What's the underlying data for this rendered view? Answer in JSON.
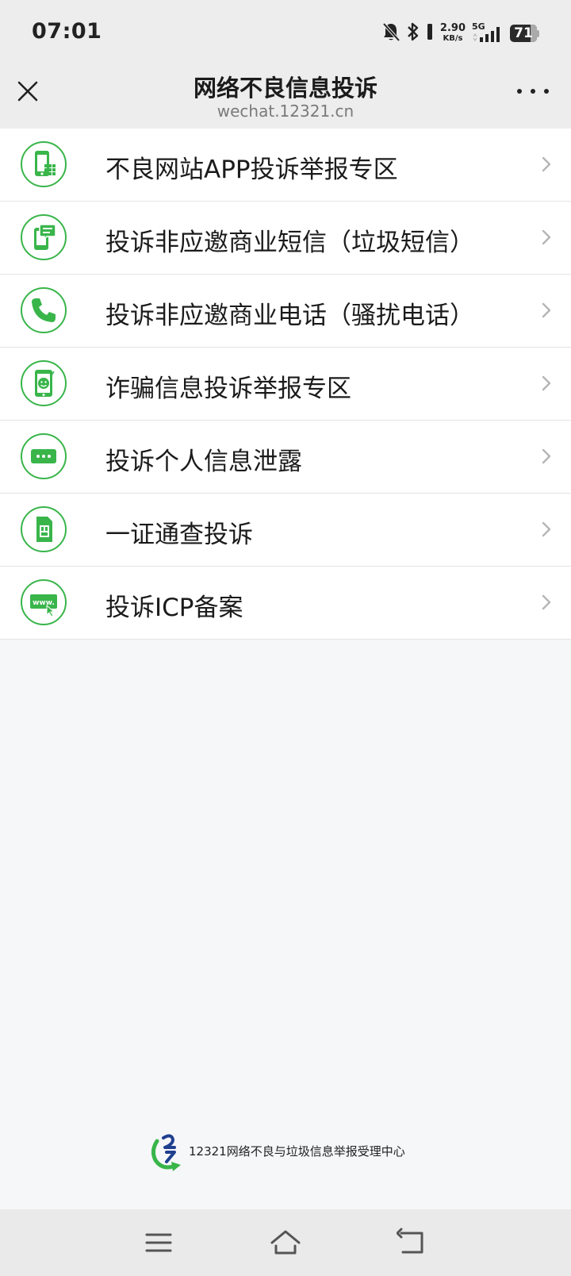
{
  "status_bar": {
    "time": "07:01",
    "net_speed_value": "2.90",
    "net_speed_unit": "KB/s",
    "network": "5G",
    "battery": "71",
    "icons": [
      "bell-muted-icon",
      "bluetooth-icon",
      "signal-icon",
      "battery-icon"
    ]
  },
  "header": {
    "title": "网络不良信息投诉",
    "subtitle": "wechat.12321.cn"
  },
  "accent_color": "#39b54a",
  "menu": {
    "items": [
      {
        "label": "不良网站APP投诉举报专区",
        "icon": "phone-grid-icon"
      },
      {
        "label": "投诉非应邀商业短信（垃圾短信）",
        "icon": "phone-message-icon"
      },
      {
        "label": "投诉非应邀商业电话（骚扰电话）",
        "icon": "phone-call-icon"
      },
      {
        "label": "诈骗信息投诉举报专区",
        "icon": "phone-fraud-icon"
      },
      {
        "label": "投诉个人信息泄露",
        "icon": "chat-dots-icon"
      },
      {
        "label": "一证通查投诉",
        "icon": "sim-card-icon"
      },
      {
        "label": "投诉ICP备案",
        "icon": "www-cursor-icon"
      }
    ]
  },
  "footer": {
    "org_name": "12321网络不良与垃圾信息举报受理中心"
  },
  "bottom_nav": {
    "items": [
      "menu-icon",
      "home-icon",
      "back-icon"
    ]
  }
}
